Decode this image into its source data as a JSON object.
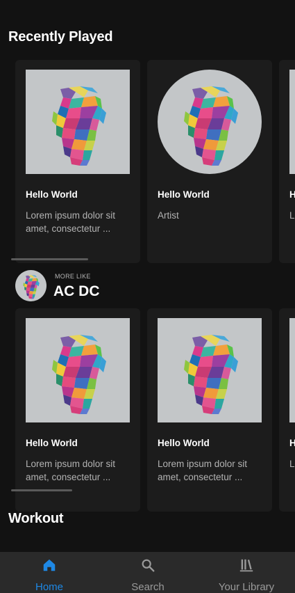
{
  "sections": {
    "recently_played": "Recently Played",
    "workout": "Workout"
  },
  "recent_cards": [
    {
      "title": "Hello World",
      "subtitle": "Lorem ipsum dolor sit amet, consectetur ..."
    },
    {
      "title": "Hello World",
      "subtitle": "Artist"
    },
    {
      "title": "H",
      "subtitle": "Lo a"
    }
  ],
  "more_like": {
    "kicker": "MORE LIKE",
    "artist": "AC DC"
  },
  "more_like_cards": [
    {
      "title": "Hello World",
      "subtitle": "Lorem ipsum dolor sit amet, consectetur ..."
    },
    {
      "title": "Hello World",
      "subtitle": "Lorem ipsum dolor sit amet, consectetur ..."
    },
    {
      "title": "H",
      "subtitle": "Lo a"
    }
  ],
  "nav": {
    "home": "Home",
    "search": "Search",
    "library": "Your Library"
  },
  "colors": {
    "background": "#121212",
    "card": "#1c1c1c",
    "nav_background": "#2a2a2a",
    "accent": "#1e88e5",
    "art_background": "#c3c6c8"
  },
  "icons": {
    "home": "home-icon",
    "search": "search-icon",
    "library": "library-icon"
  }
}
